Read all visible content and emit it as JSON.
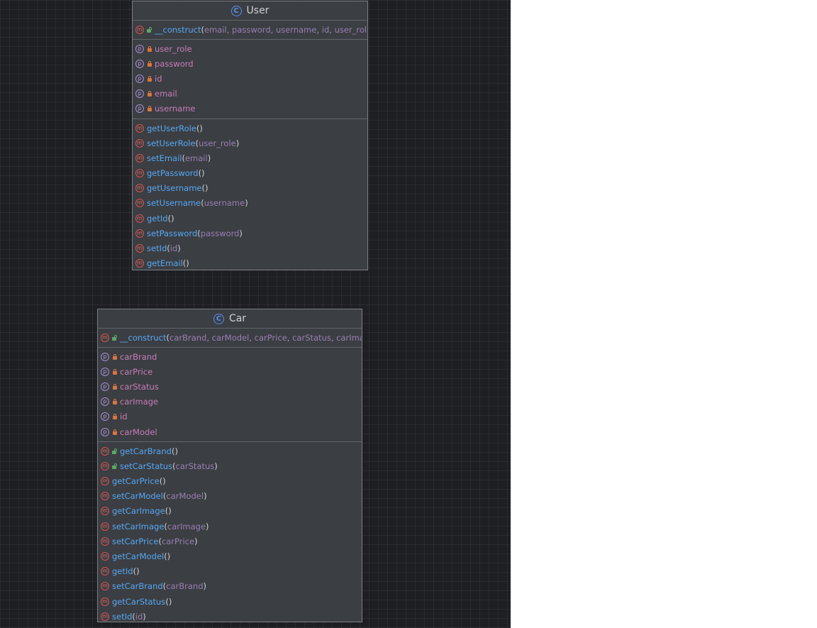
{
  "classes": [
    {
      "id": "user",
      "name": "User",
      "constructor": {
        "name": "__construct",
        "params": [
          "email",
          "password",
          "username",
          "id",
          "user_role"
        ]
      },
      "properties": [
        "user_role",
        "password",
        "id",
        "email",
        "username"
      ],
      "methods": [
        {
          "name": "getUserRole",
          "params": []
        },
        {
          "name": "setUserRole",
          "params": [
            "user_role"
          ]
        },
        {
          "name": "setEmail",
          "params": [
            "email"
          ]
        },
        {
          "name": "getPassword",
          "params": []
        },
        {
          "name": "getUsername",
          "params": []
        },
        {
          "name": "setUsername",
          "params": [
            "username"
          ]
        },
        {
          "name": "getId",
          "params": []
        },
        {
          "name": "setPassword",
          "params": [
            "password"
          ]
        },
        {
          "name": "setId",
          "params": [
            "id"
          ]
        },
        {
          "name": "getEmail",
          "params": []
        }
      ]
    },
    {
      "id": "car",
      "name": "Car",
      "constructor": {
        "name": "__construct",
        "params": [
          "carBrand",
          "carModel",
          "carPrice",
          "carStatus",
          "carImage"
        ]
      },
      "properties": [
        "carBrand",
        "carPrice",
        "carStatus",
        "carImage",
        "id",
        "carModel"
      ],
      "public_methods": [
        {
          "name": "getCarBrand",
          "params": []
        },
        {
          "name": "setCarStatus",
          "params": [
            "carStatus"
          ]
        }
      ],
      "methods": [
        {
          "name": "getCarPrice",
          "params": []
        },
        {
          "name": "setCarModel",
          "params": [
            "carModel"
          ]
        },
        {
          "name": "getCarImage",
          "params": []
        },
        {
          "name": "setCarImage",
          "params": [
            "carImage"
          ]
        },
        {
          "name": "setCarPrice",
          "params": [
            "carPrice"
          ]
        },
        {
          "name": "getCarModel",
          "params": []
        },
        {
          "name": "getId",
          "params": []
        },
        {
          "name": "setCarBrand",
          "params": [
            "carBrand"
          ]
        },
        {
          "name": "getCarStatus",
          "params": []
        },
        {
          "name": "setId",
          "params": [
            "id"
          ]
        }
      ]
    }
  ],
  "icons": {
    "class": "class-icon",
    "method": "method-icon",
    "property": "property-icon",
    "private": "lock-icon",
    "public": "unlock-icon"
  },
  "colors": {
    "canvas": "#1e1f22",
    "box": "#3b3e42",
    "method_name": "#56a8f5",
    "property_name": "#c77dbb",
    "param": "#9a7fb5",
    "method_icon": "#d9534f",
    "property_icon": "#a98fd8",
    "class_icon": "#5b8def"
  }
}
